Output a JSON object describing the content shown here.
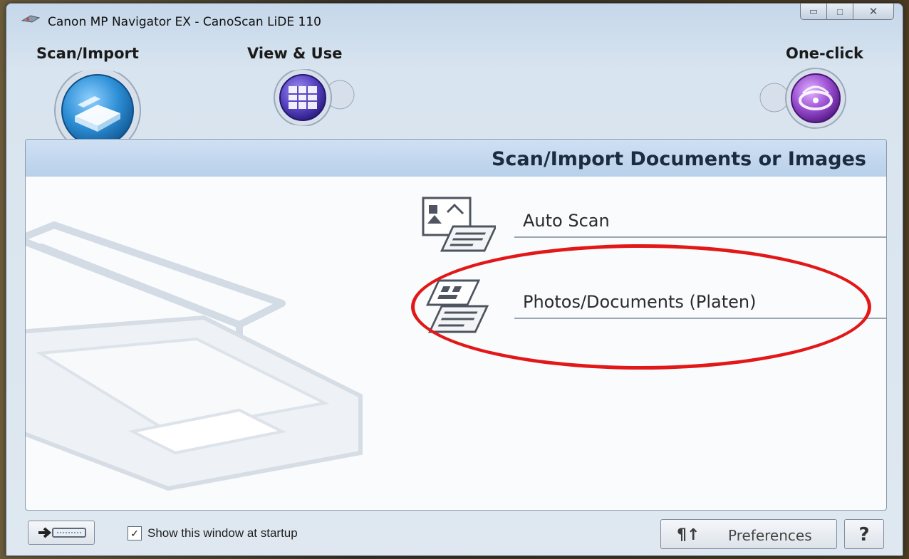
{
  "window": {
    "title": "Canon MP Navigator EX - CanoScan LiDE 110",
    "minimize_glyph": "▭",
    "maximize_glyph": "□",
    "close_glyph": "✕"
  },
  "nav": {
    "tabs": [
      {
        "label": "Scan/Import",
        "icon": "scanner-icon",
        "selected": true
      },
      {
        "label": "View & Use",
        "icon": "grid-view-icon",
        "selected": false
      },
      {
        "label": "One-click",
        "icon": "one-click-icon",
        "selected": false
      }
    ]
  },
  "main": {
    "header_title": "Scan/Import Documents or Images",
    "options": [
      {
        "label": "Auto Scan",
        "icon": "auto-scan-icon"
      },
      {
        "label": "Photos/Documents (Platen)",
        "icon": "platen-documents-icon",
        "highlighted": true
      }
    ],
    "highlight_color": "#e21717"
  },
  "footer": {
    "show_at_startup_label": "Show this window at startup",
    "show_at_startup_checked": true,
    "check_glyph": "✓",
    "preferences_label": "Preferences",
    "preferences_icon_glyph": "¶↑",
    "help_label": "?"
  },
  "colors": {
    "accent_blue": "#2e8fd6",
    "view_purple": "#5b45c4",
    "oneclick_violet": "#9a4fd1"
  }
}
